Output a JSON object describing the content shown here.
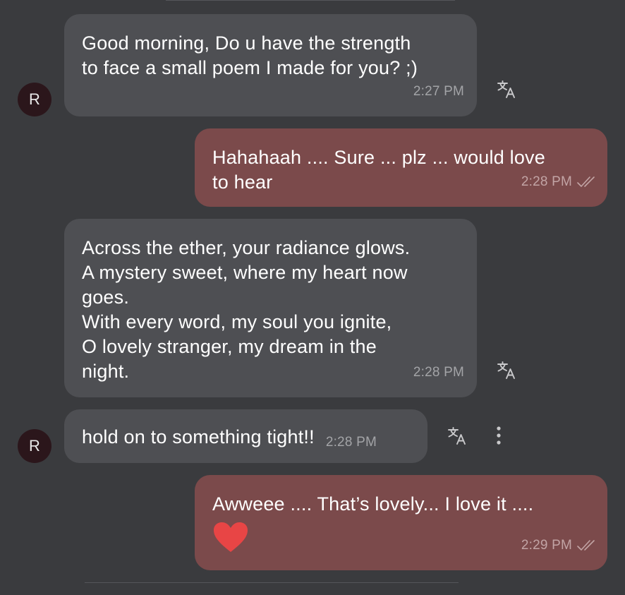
{
  "colors": {
    "background": "#3a3b3e",
    "incoming_bubble": "#4e4f53",
    "outgoing_bubble": "#7b4a4b",
    "avatar": "#2b161b",
    "heart": "#e84545"
  },
  "messages": [
    {
      "direction": "incoming",
      "text": "Good morning, Do u have the strength\nto face a small poem I made for you? ;)",
      "time": "2:27 PM",
      "sender_initial": "R",
      "icon": "translate-icon"
    },
    {
      "direction": "outgoing",
      "text": "Hahahaah .... Sure ... plz ... would love\nto hear",
      "time": "2:28 PM",
      "status_icon": "double-check-icon"
    },
    {
      "direction": "incoming",
      "text": "Across the ether, your radiance glows.\nA mystery sweet, where my heart now\ngoes.\nWith every word, my soul you ignite,\nO lovely stranger, my dream in the\nnight.",
      "time": "2:28 PM",
      "icon": "translate-icon"
    },
    {
      "direction": "incoming",
      "text": "hold on to something tight!!",
      "time": "2:28 PM",
      "sender_initial": "R",
      "icon": "translate-icon",
      "more_icon": "more-vertical-icon"
    },
    {
      "direction": "outgoing",
      "text": "Awweee .... That’s lovely... I love it ....",
      "emoji": "heart-emoji",
      "time": "2:29 PM",
      "status_icon": "double-check-icon"
    }
  ]
}
